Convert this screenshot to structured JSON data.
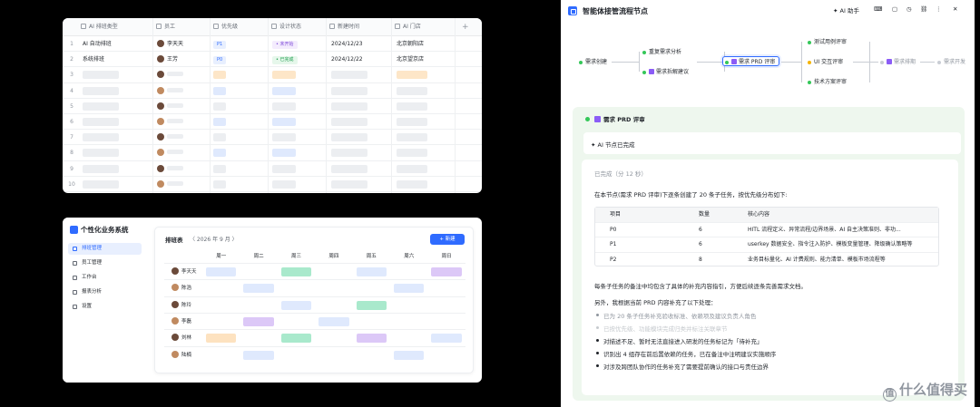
{
  "sheet": {
    "columns": [
      {
        "label": "AI 排班类型",
        "icon": "ai-column-icon"
      },
      {
        "label": "员工",
        "icon": "person-icon"
      },
      {
        "label": "优先级",
        "icon": "priority-icon"
      },
      {
        "label": "设计状态",
        "icon": "status-icon"
      },
      {
        "label": "新建时间",
        "icon": "calendar-icon"
      },
      {
        "label": "AI 门店",
        "icon": "ai-column-icon"
      }
    ],
    "add_column": "+",
    "rows": [
      {
        "num": "1",
        "type": "AI 自动排班",
        "person": "李天天",
        "priority": "P1",
        "status": "未开始",
        "date": "2024/12/23",
        "store": "北京朝阳店"
      },
      {
        "num": "2",
        "type": "系统排班",
        "person": "王芳",
        "priority": "P0",
        "status": "已完成",
        "date": "2024/12/22",
        "store": "北京望京店"
      },
      {
        "num": "3"
      },
      {
        "num": "4"
      },
      {
        "num": "5"
      },
      {
        "num": "6"
      },
      {
        "num": "7"
      },
      {
        "num": "8"
      },
      {
        "num": "9"
      },
      {
        "num": "10"
      }
    ],
    "colors": {
      "p1_bg": "#e8effe",
      "p1_fg": "#2f6bff",
      "p0_bg": "#e8effe",
      "status1_bg": "#f4ecfd",
      "status1_fg": "#7e4bd9",
      "status2_bg": "#e6f7eb",
      "status2_fg": "#1a9c4b",
      "ph_blue": "#dfe9fd",
      "ph_orange": "#fde6c8",
      "ph_gray": "#eceef1"
    }
  },
  "app": {
    "title": "个性化业务系统",
    "nav": [
      {
        "label": "排班管理",
        "active": true
      },
      {
        "label": "员工管理",
        "active": false
      },
      {
        "label": "工作台",
        "active": false
      },
      {
        "label": "报表分析",
        "active": false
      },
      {
        "label": "设置",
        "active": false
      }
    ],
    "card_title": "排班表",
    "month": "〈 2026 年 9 月 〉",
    "new_button": "+ 新建",
    "weekdays": [
      "周一",
      "周二",
      "周三",
      "周四",
      "周五",
      "周六",
      "周日"
    ],
    "people": [
      "李天天",
      "陈浩",
      "陈玲",
      "李磊",
      "刘林",
      "陆楠"
    ],
    "shifts": [
      [
        {
          "d": 0,
          "c": "#dfe9fd"
        },
        {
          "d": 2,
          "c": "#a9e9cc"
        },
        {
          "d": 4,
          "c": "#dfe9fd"
        },
        {
          "d": 6,
          "c": "#dcc8f7"
        }
      ],
      [
        {
          "d": 1,
          "c": "#dfe9fd"
        },
        {
          "d": 5,
          "c": "#dfe9fd"
        }
      ],
      [
        {
          "d": 2,
          "c": "#dfe9fd"
        },
        {
          "d": 4,
          "c": "#a9e9cc"
        }
      ],
      [
        {
          "d": 1,
          "c": "#dcc8f7"
        },
        {
          "d": 3,
          "c": "#dfe9fd"
        }
      ],
      [
        {
          "d": 0,
          "c": "#fde2c0"
        },
        {
          "d": 2,
          "c": "#a9e9cc"
        },
        {
          "d": 4,
          "c": "#dcc8f7"
        },
        {
          "d": 6,
          "c": "#dfe9fd"
        }
      ],
      [
        {
          "d": 1,
          "c": "#dfe9fd"
        },
        {
          "d": 5,
          "c": "#dfe9fd"
        }
      ]
    ]
  },
  "flow": {
    "title": "智能体接管流程节点",
    "toolbar": {
      "ai_assistant": "✦ AI 助手"
    },
    "nodes": {
      "create": "需求创建",
      "analyze": "重复需求分析",
      "split": "需求拆解建议",
      "prd": "需求 PRD 评审",
      "testcase": "测试用例评审",
      "ui": "UI 交互评审",
      "tech": "技术方案评审",
      "schedule": "需求排期",
      "dev": "需求开发"
    },
    "detail": {
      "node_title": "需求 PRD 评审",
      "done": "✦  AI 节点已完成",
      "completed": "已完成（分 12 秒）",
      "intro": "在本节点(需求 PRD 评审)下逐条创建了 20 条子任务，按优先级分布如下:",
      "table": {
        "headers": [
          "项目",
          "数量",
          "核心内容"
        ],
        "rows": [
          [
            "P0",
            "6",
            "HITL 流程定义、异常流程/边界场景、AI 自主决策准则、非功..."
          ],
          [
            "P1",
            "6",
            "userkey 数据安全、指令注入防护、模板变量管理、降级确认策略等"
          ],
          [
            "P2",
            "8",
            "业务目标量化、AI 计费规则、能力清单、模板市场流程等"
          ]
        ]
      },
      "note1": "每条子任务的备注中均包含了具体的补充内容指引，方便后续逐条完善需求文档。",
      "note2": "另外，我根据当前 PRD 内容补充了以下处理：",
      "bullets": [
        "已为 20 条子任务补充验收标准、依赖项及建议负责人角色",
        "已按优先级、功能模块完成归类并标注关联章节",
        "对描述不足、暂时无法直接进入研发的任务标记为「待补充」",
        "识别出 4 组存在前后置依赖的任务，已在备注中注明建议实施顺序",
        "对涉及跨团队协作的任务补充了需要提前确认的接口与责任边界"
      ]
    },
    "watermark": "什么值得买",
    "watermark_logo": "值"
  }
}
